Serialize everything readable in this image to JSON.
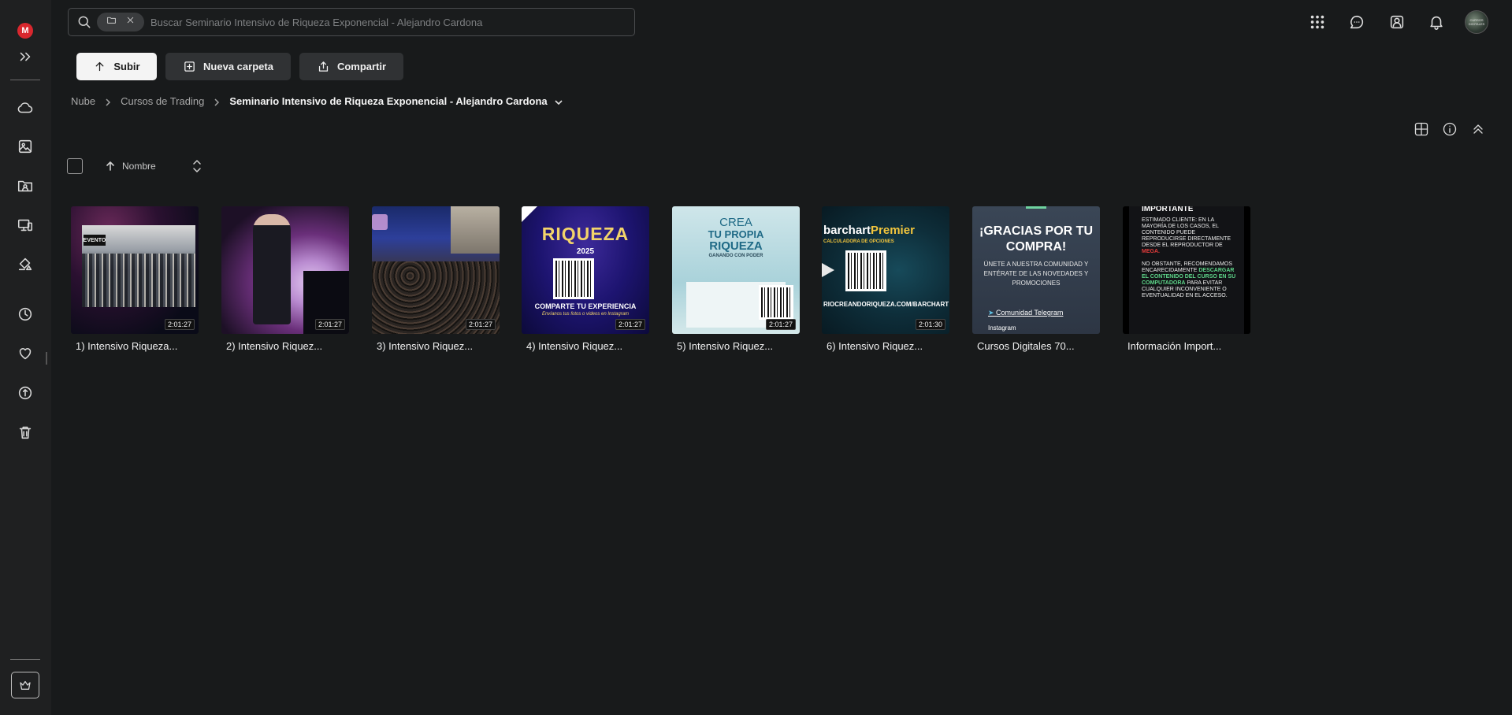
{
  "sidebar": {
    "logo_letter": "M",
    "items": [
      {
        "icon": "expand-icon"
      },
      {
        "icon": "cloud-drive-icon"
      },
      {
        "icon": "photos-icon"
      },
      {
        "icon": "shared-folders-icon"
      },
      {
        "icon": "devices-icon"
      },
      {
        "icon": "transfers-icon"
      },
      {
        "icon": "recents-icon"
      },
      {
        "icon": "favourites-icon"
      },
      {
        "icon": "backups-icon"
      },
      {
        "icon": "rubbish-bin-icon"
      },
      {
        "icon": "upgrade-crown-icon"
      }
    ]
  },
  "search": {
    "placeholder": "Buscar Seminario Intensivo de Riqueza Exponencial - Alejandro Cardona"
  },
  "topbar": {
    "icons": [
      "apps-grid-icon",
      "chat-icon",
      "contacts-icon",
      "notifications-bell-icon"
    ],
    "avatar_text": "CURSOS DIGITALES"
  },
  "toolbar": {
    "upload_label": "Subir",
    "new_folder_label": "Nueva carpeta",
    "share_label": "Compartir"
  },
  "breadcrumb": {
    "items": [
      "Nube",
      "Cursos de Trading"
    ],
    "current": "Seminario Intensivo de Riqueza Exponencial - Alejandro Cardona"
  },
  "view": {
    "icons": [
      "grid-view-icon",
      "info-icon",
      "collapse-icon"
    ]
  },
  "sort": {
    "label": "Nombre",
    "direction": "ascending"
  },
  "files": [
    {
      "name": "1) Intensivo Riqueza...",
      "duration": "2:01:27"
    },
    {
      "name": "2) Intensivo Riquez...",
      "duration": "2:01:27"
    },
    {
      "name": "3) Intensivo Riquez...",
      "duration": "2:01:27"
    },
    {
      "name": "4) Intensivo Riquez...",
      "duration": "2:01:27"
    },
    {
      "name": "5) Intensivo Riquez...",
      "duration": "2:01:27"
    },
    {
      "name": "6) Intensivo Riquez...",
      "duration": "2:01:30"
    },
    {
      "name": "Cursos Digitales 70...",
      "duration": ""
    },
    {
      "name": "Información Import...",
      "duration": ""
    }
  ],
  "thumb_text": {
    "t1_banner": "EVENTO",
    "t4_title": "RIQUEZA",
    "t4_year": "2025",
    "t4_footer": "COMPARTE TU EXPERIENCIA",
    "t4_sub": "Envíanos tus fotos o videos en Instagram",
    "t5_line1": "CREA",
    "t5_line2": "TU PROPIA",
    "t5_line3": "RIQUEZA",
    "t5_line4": "GANANDO CON PODER",
    "t6_brand": "barchart",
    "t6_brand2": "Premier",
    "t6_sub": "CALCULADORA DE OPCIONES",
    "t6_url": "RIOCREANDORIQUEZA.COM/BARCHART",
    "t7_title": "¡GRACIAS POR TU COMPRA!",
    "t7_body": "ÚNETE A NUESTRA COMUNIDAD Y ENTÉRATE DE LAS NOVEDADES Y PROMOCIONES",
    "t7_link": "Comunidad Telegram",
    "t7_link2": "Instagram",
    "t8_head": "IMPORTANTE",
    "t8_body1": "ESTIMADO CLIENTE: EN LA MAYORÍA DE LOS CASOS, EL CONTENIDO PUEDE REPRODUCIRSE DIRECTAMENTE DESDE EL REPRODUCTOR DE",
    "t8_mega": "MEGA.",
    "t8_body2": "NO OBSTANTE, RECOMENDAMOS ENCARECIDAMENTE",
    "t8_green": "DESCARGAR EL CONTENIDO DEL CURSO EN SU COMPUTADORA",
    "t8_body3": "PARA EVITAR CUALQUIER INCONVENIENTE O EVENTUALIDAD EN EL ACCESO."
  },
  "colors": {
    "background": "#181a1b",
    "sidebar": "#1f2021",
    "accent_red": "#d9272e",
    "button_secondary": "#303234"
  }
}
